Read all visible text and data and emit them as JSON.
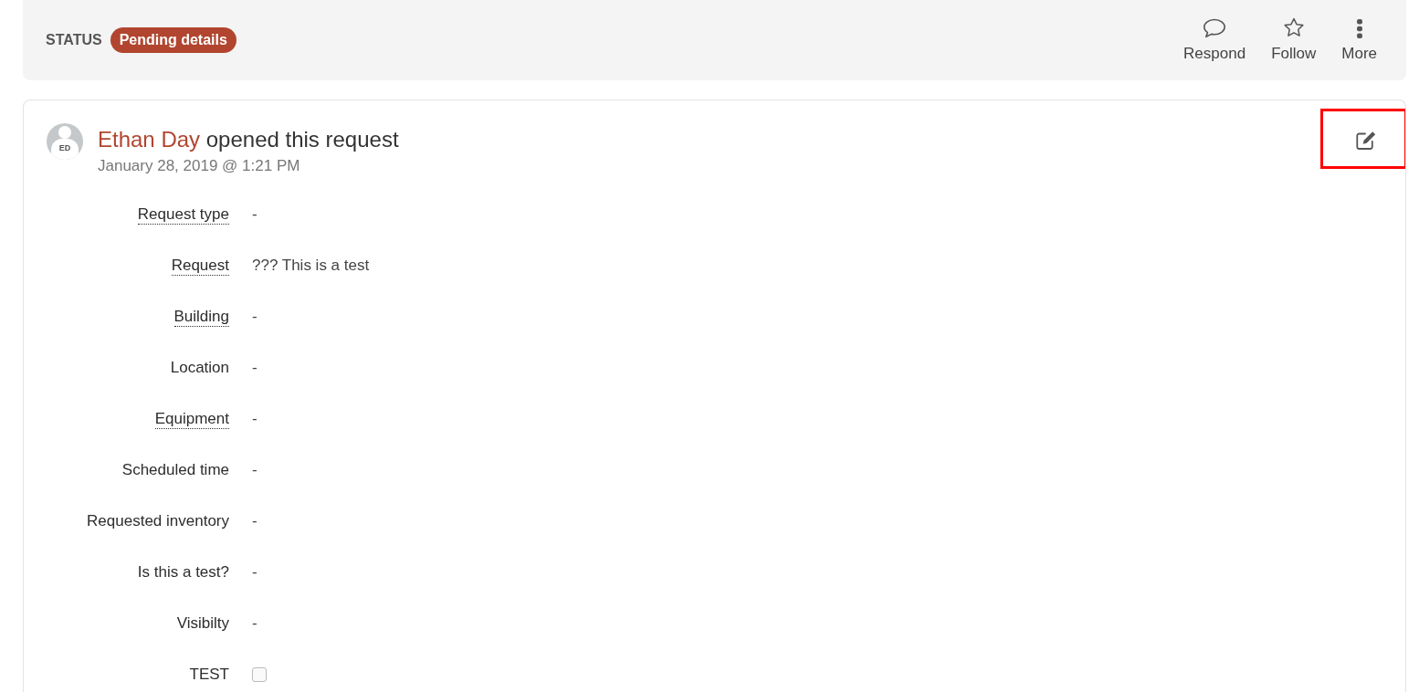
{
  "status_bar": {
    "label": "STATUS",
    "badge": "Pending details",
    "actions": [
      {
        "kind": "respond",
        "label": "Respond"
      },
      {
        "kind": "follow",
        "label": "Follow"
      },
      {
        "kind": "more",
        "label": "More"
      }
    ]
  },
  "request": {
    "avatar_initials": "ED",
    "author": "Ethan Day",
    "action": "opened this request",
    "timestamp": "January 28, 2019 @ 1:21 PM",
    "edit_highlighted": true,
    "fields": [
      {
        "kind": "text",
        "label": "Request type",
        "has_tooltip": true,
        "value": "-"
      },
      {
        "kind": "text",
        "label": "Request",
        "has_tooltip": true,
        "value": "??? This is a test"
      },
      {
        "kind": "text",
        "label": "Building",
        "has_tooltip": true,
        "value": "-"
      },
      {
        "kind": "text",
        "label": "Location",
        "has_tooltip": false,
        "value": "-"
      },
      {
        "kind": "text",
        "label": "Equipment",
        "has_tooltip": true,
        "value": "-"
      },
      {
        "kind": "text",
        "label": "Scheduled time",
        "has_tooltip": false,
        "value": "-"
      },
      {
        "kind": "text",
        "label": "Requested inventory",
        "has_tooltip": false,
        "value": "-"
      },
      {
        "kind": "text",
        "label": "Is this a test?",
        "has_tooltip": false,
        "value": "-"
      },
      {
        "kind": "text",
        "label": "Visibilty",
        "has_tooltip": false,
        "value": "-"
      },
      {
        "kind": "checkbox",
        "label": "TEST",
        "has_tooltip": false,
        "checked": false
      }
    ]
  }
}
